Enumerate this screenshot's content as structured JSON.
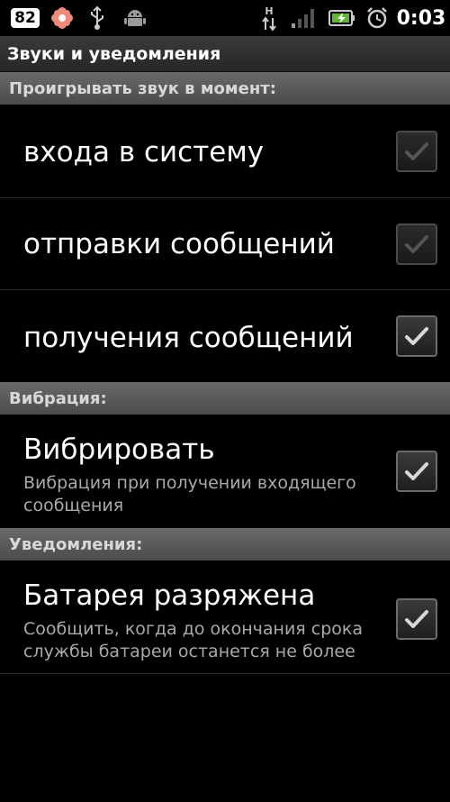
{
  "status_bar": {
    "notification_count": "82",
    "time": "0:03",
    "icons": [
      "count-badge-icon",
      "flower-icon",
      "usb-icon",
      "android-debug-icon",
      "hspa-data-icon",
      "signal-icon",
      "battery-charging-icon",
      "alarm-icon"
    ]
  },
  "title": "Звуки и уведомления",
  "sections": {
    "sound": {
      "header": "Проигрывать звук в момент:",
      "items": [
        {
          "title": "входа в систему",
          "checked": true,
          "enabled": false
        },
        {
          "title": "отправки сообщений",
          "checked": true,
          "enabled": false
        },
        {
          "title": "получения сообщений",
          "checked": true,
          "enabled": true
        }
      ]
    },
    "vibration": {
      "header": "Вибрация:",
      "items": [
        {
          "title": "Вибрировать",
          "summary": "Вибрация при получении входящего сообщения",
          "checked": true
        }
      ]
    },
    "notifications": {
      "header": "Уведомления:",
      "items": [
        {
          "title": "Батарея разряжена",
          "summary": "Сообщить, когда до окончания срока службы батареи останется не более",
          "checked": true
        }
      ]
    }
  },
  "colors": {
    "background": "#000000",
    "section_header": "#5a5a5a",
    "title_bar": "#2e2e2e",
    "summary_text": "#a9a9a9",
    "check_enabled": "#d8d8d8",
    "check_disabled": "#555555"
  }
}
